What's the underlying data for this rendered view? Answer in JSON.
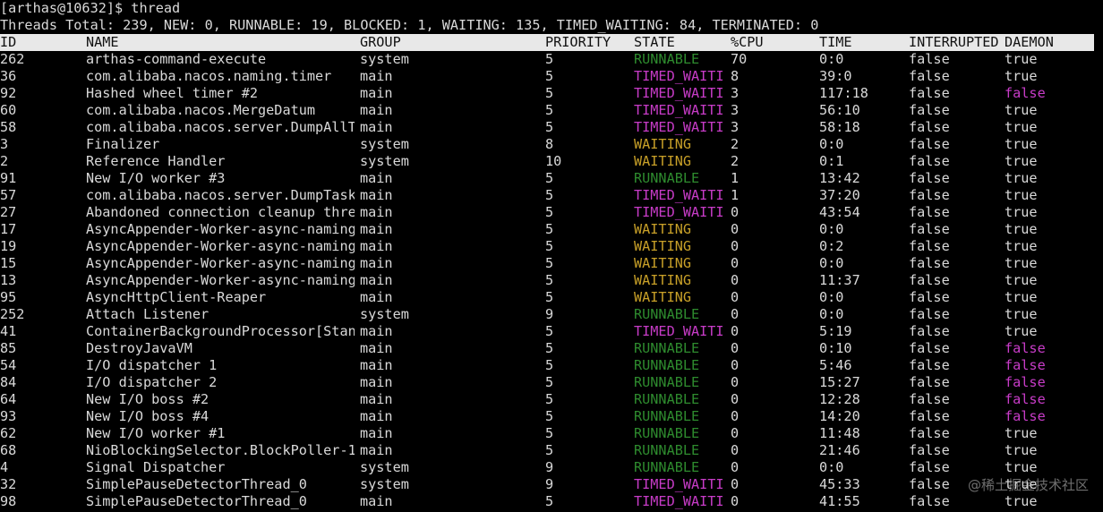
{
  "terminal": {
    "prompt": "[arthas@10632]$ thread",
    "summary": "Threads Total: 239, NEW: 0, RUNNABLE: 19, BLOCKED: 1, WAITING: 135, TIMED_WAITING: 84, TERMINATED: 0"
  },
  "table": {
    "headers": [
      "ID",
      "NAME",
      "GROUP",
      "PRIORITY",
      "STATE",
      "%CPU",
      "TIME",
      "INTERRUPTED",
      "DAEMON"
    ],
    "rows": [
      [
        "262",
        "arthas-command-execute",
        "system",
        "5",
        "RUNNABLE",
        "70",
        "0:0",
        "false",
        "true"
      ],
      [
        "36",
        "com.alibaba.nacos.naming.timer",
        "main",
        "5",
        "TIMED_WAITI",
        "8",
        "39:0",
        "false",
        "true"
      ],
      [
        "92",
        "Hashed wheel timer #2",
        "main",
        "5",
        "TIMED_WAITI",
        "3",
        "117:18",
        "false",
        "false"
      ],
      [
        "60",
        "com.alibaba.nacos.MergeDatum",
        "main",
        "5",
        "TIMED_WAITI",
        "3",
        "56:10",
        "false",
        "true"
      ],
      [
        "58",
        "com.alibaba.nacos.server.DumpAllT",
        "main",
        "5",
        "TIMED_WAITI",
        "3",
        "58:18",
        "false",
        "true"
      ],
      [
        "3",
        "Finalizer",
        "system",
        "8",
        "WAITING",
        "2",
        "0:0",
        "false",
        "true"
      ],
      [
        "2",
        "Reference Handler",
        "system",
        "10",
        "WAITING",
        "2",
        "0:1",
        "false",
        "true"
      ],
      [
        "91",
        "New I/O worker #3",
        "main",
        "5",
        "RUNNABLE",
        "1",
        "13:42",
        "false",
        "true"
      ],
      [
        "57",
        "com.alibaba.nacos.server.DumpTask",
        "main",
        "5",
        "TIMED_WAITI",
        "1",
        "37:20",
        "false",
        "true"
      ],
      [
        "27",
        "Abandoned connection cleanup thre",
        "main",
        "5",
        "TIMED_WAITI",
        "0",
        "43:54",
        "false",
        "true"
      ],
      [
        "17",
        "AsyncAppender-Worker-async-naming",
        "main",
        "5",
        "WAITING",
        "0",
        "0:0",
        "false",
        "true"
      ],
      [
        "19",
        "AsyncAppender-Worker-async-naming",
        "main",
        "5",
        "WAITING",
        "0",
        "0:2",
        "false",
        "true"
      ],
      [
        "15",
        "AsyncAppender-Worker-async-naming",
        "main",
        "5",
        "WAITING",
        "0",
        "0:0",
        "false",
        "true"
      ],
      [
        "13",
        "AsyncAppender-Worker-async-naming",
        "main",
        "5",
        "WAITING",
        "0",
        "11:37",
        "false",
        "true"
      ],
      [
        "95",
        "AsyncHttpClient-Reaper",
        "main",
        "5",
        "WAITING",
        "0",
        "0:0",
        "false",
        "true"
      ],
      [
        "252",
        "Attach Listener",
        "system",
        "9",
        "RUNNABLE",
        "0",
        "0:0",
        "false",
        "true"
      ],
      [
        "41",
        "ContainerBackgroundProcessor[Stan",
        "main",
        "5",
        "TIMED_WAITI",
        "0",
        "5:19",
        "false",
        "true"
      ],
      [
        "85",
        "DestroyJavaVM",
        "main",
        "5",
        "RUNNABLE",
        "0",
        "0:10",
        "false",
        "false"
      ],
      [
        "54",
        "I/O dispatcher 1",
        "main",
        "5",
        "RUNNABLE",
        "0",
        "5:46",
        "false",
        "false"
      ],
      [
        "84",
        "I/O dispatcher 2",
        "main",
        "5",
        "RUNNABLE",
        "0",
        "15:27",
        "false",
        "false"
      ],
      [
        "64",
        "New I/O boss #2",
        "main",
        "5",
        "RUNNABLE",
        "0",
        "12:28",
        "false",
        "false"
      ],
      [
        "93",
        "New I/O boss #4",
        "main",
        "5",
        "RUNNABLE",
        "0",
        "14:20",
        "false",
        "false"
      ],
      [
        "62",
        "New I/O worker #1",
        "main",
        "5",
        "RUNNABLE",
        "0",
        "11:48",
        "false",
        "true"
      ],
      [
        "68",
        "NioBlockingSelector.BlockPoller-1",
        "main",
        "5",
        "RUNNABLE",
        "0",
        "21:46",
        "false",
        "true"
      ],
      [
        "4",
        "Signal Dispatcher",
        "system",
        "9",
        "RUNNABLE",
        "0",
        "0:0",
        "false",
        "true"
      ],
      [
        "32",
        "SimplePauseDetectorThread_0",
        "system",
        "9",
        "TIMED_WAITI",
        "0",
        "45:33",
        "false",
        "true"
      ],
      [
        "98",
        "SimplePauseDetectorThread_0",
        "main",
        "5",
        "TIMED_WAITI",
        "0",
        "41:55",
        "false",
        "true"
      ]
    ]
  },
  "colors": {
    "background": "#000000",
    "text": "#d9d9d9",
    "header_bg": "#e8e8e8",
    "runnable": "#2e8b2e",
    "timed_waiting": "#c83cc8",
    "waiting": "#c8a028",
    "daemon_false": "#c83cc8"
  },
  "watermark": "@稀土掘金技术社区"
}
